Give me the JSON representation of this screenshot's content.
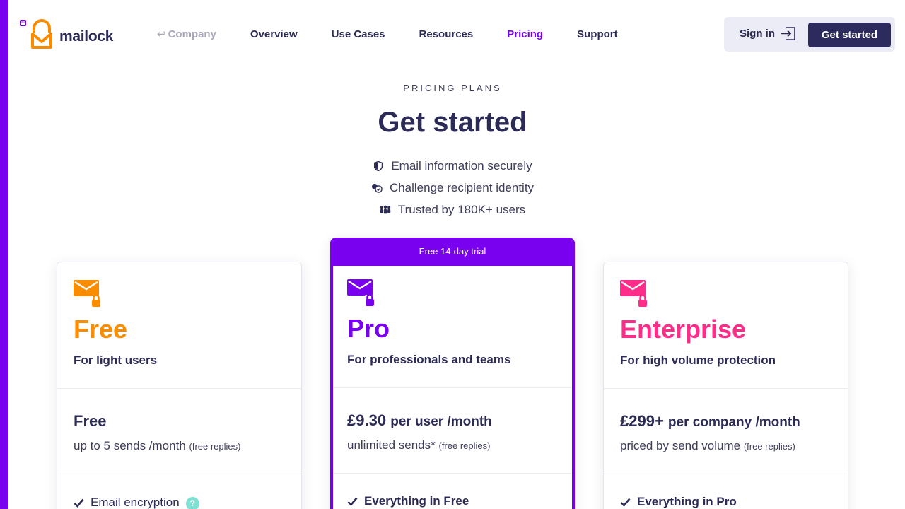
{
  "brand": {
    "name": "mailock",
    "accent": "#7a00f0",
    "orange": "#fa8c00",
    "pink": "#ff2d8a",
    "navy": "#2d2b5e"
  },
  "nav": {
    "back": "Company",
    "items": [
      "Overview",
      "Use Cases",
      "Resources",
      "Pricing",
      "Support"
    ],
    "active": "Pricing"
  },
  "auth": {
    "signin": "Sign in",
    "cta": "Get started"
  },
  "hero": {
    "eyebrow": "PRICING PLANS",
    "title": "Get started",
    "features": [
      {
        "icon": "shield-icon",
        "text": "Email information securely"
      },
      {
        "icon": "identity-check-icon",
        "text": "Challenge recipient identity"
      },
      {
        "icon": "users-icon",
        "text": "Trusted by 180K+ users"
      }
    ]
  },
  "plans": [
    {
      "name": "Free",
      "subtitle": "For light users",
      "color": "#fa8c00",
      "price": "Free",
      "per": "",
      "sends": "up to 5 sends /month",
      "note": "(free replies)",
      "feature": "Email encryption"
    },
    {
      "name": "Pro",
      "subtitle": "For professionals and teams",
      "color": "#7a00f0",
      "badge": "Free 14-day trial",
      "price": "£9.30",
      "per": "per user /month",
      "sends": "unlimited sends*",
      "note": "(free replies)",
      "feature": "Everything in Free"
    },
    {
      "name": "Enterprise",
      "subtitle": "For high volume protection",
      "color": "#ff2d8a",
      "price": "£299+",
      "per": "per company /month",
      "sends": "priced by send volume",
      "note": "(free replies)",
      "feature": "Everything in Pro"
    }
  ]
}
